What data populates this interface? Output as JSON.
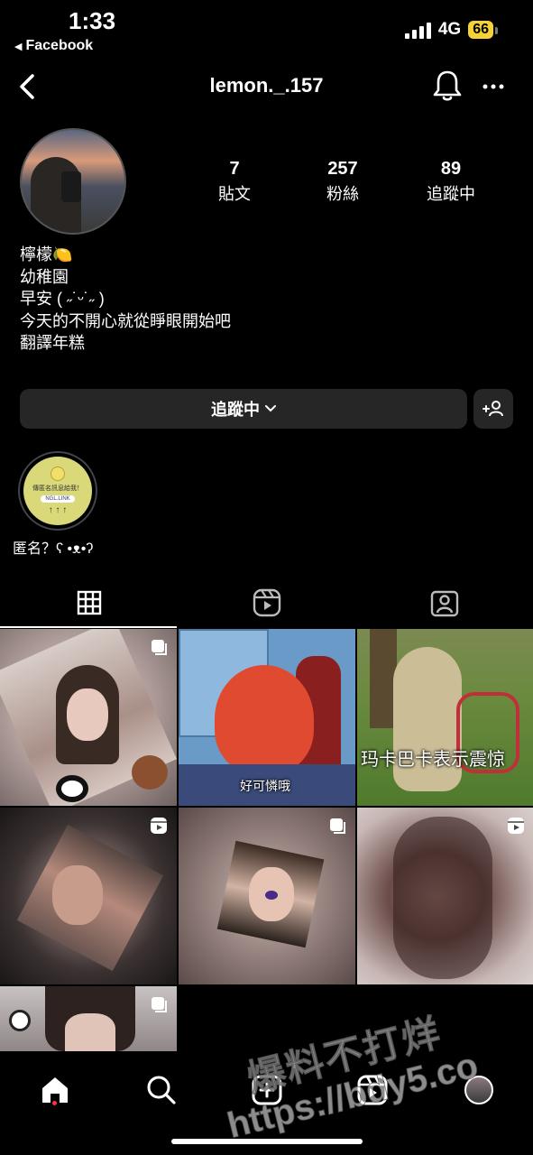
{
  "status_bar": {
    "time": "1:33",
    "back_app": "Facebook",
    "network": "4G",
    "battery": "66"
  },
  "header": {
    "username": "lemon._.157",
    "icons": [
      "back-icon",
      "bell-icon",
      "more-icon"
    ]
  },
  "profile": {
    "stats": [
      {
        "value": "7",
        "label": "貼文"
      },
      {
        "value": "257",
        "label": "粉絲"
      },
      {
        "value": "89",
        "label": "追蹤中"
      }
    ],
    "bio": [
      "檸檬🍋",
      "幼稚園",
      "早安 ( ˶˙ᵕ˙˶ )",
      "今天的不開心就從睜眼開始吧",
      "翻譯年糕"
    ],
    "follow_button": "追蹤中",
    "highlight": {
      "label": "匿名？ʕ •ᴥ•ʔ",
      "inner_text": "傳匿名訊息給我！",
      "inner_link": "NGL.LINK"
    }
  },
  "tabs": [
    "grid-icon",
    "reels-icon",
    "tagged-icon"
  ],
  "posts": [
    {
      "type": "carousel",
      "caption": ""
    },
    {
      "type": "carousel",
      "caption": "好可憐哦"
    },
    {
      "type": "image",
      "caption": "玛卡巴卡表示震惊"
    },
    {
      "type": "reel",
      "caption": ""
    },
    {
      "type": "carousel",
      "caption": ""
    },
    {
      "type": "reel",
      "caption": ""
    },
    {
      "type": "carousel",
      "caption": ""
    }
  ],
  "bottom_nav": [
    "home-icon",
    "search-icon",
    "create-icon",
    "reels-icon",
    "profile-avatar"
  ],
  "watermark": {
    "line1": "爆料不打烊",
    "line2": "https://bdy5.co"
  },
  "colors": {
    "background": "#000000",
    "button_bg": "#262626",
    "battery": "#f5d337",
    "notification_dot": "#ff3040"
  }
}
